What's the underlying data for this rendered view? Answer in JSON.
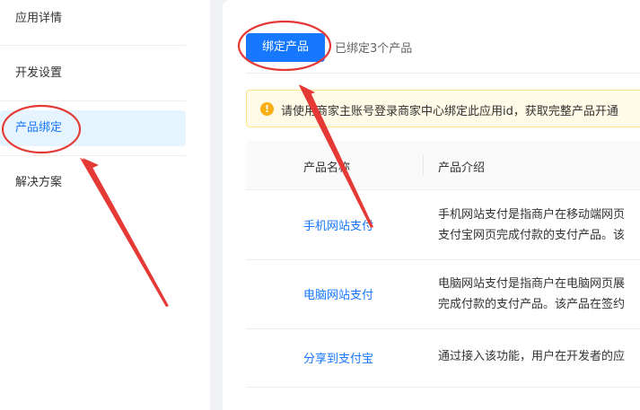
{
  "sidebar": {
    "items": [
      {
        "label": "应用详情",
        "active": false
      },
      {
        "label": "开发设置",
        "active": false
      },
      {
        "label": "产品绑定",
        "active": true
      },
      {
        "label": "解决方案",
        "active": false
      }
    ]
  },
  "toolbar": {
    "bind_label": "绑定产品",
    "bound_count_text": "已绑定3个产品"
  },
  "notice": {
    "icon": "warning-icon",
    "text": "请使用商家主账号登录商家中心绑定此应用id，获取完整产品开通"
  },
  "table": {
    "columns": [
      "产品名称",
      "产品介绍"
    ],
    "rows": [
      {
        "name": "手机网站支付",
        "desc_line1": "手机网站支付是指商户在移动端网页",
        "desc_line2": "支付宝网页完成付款的支付产品。该"
      },
      {
        "name": "电脑网站支付",
        "desc_line1": "电脑网站支付是指商户在电脑网页展",
        "desc_line2": "完成付款的支付产品。该产品在签约"
      },
      {
        "name": "分享到支付宝",
        "desc_line1": "通过接入该功能，用户在开发者的应",
        "desc_line2": ""
      }
    ]
  },
  "colors": {
    "accent": "#1677ff",
    "annotation": "#e53935",
    "notice_bg": "#fffbe6",
    "warning": "#faad14"
  }
}
